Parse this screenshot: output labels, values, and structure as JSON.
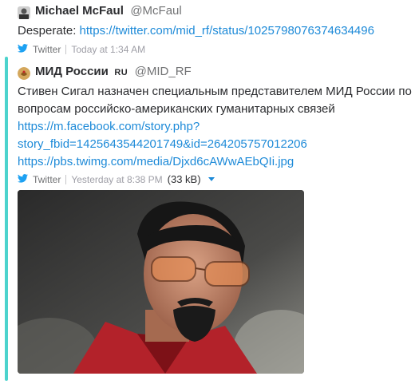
{
  "tweet1": {
    "author": "Michael McFaul",
    "handle": "@McFaul",
    "text_prefix": "Desperate: ",
    "link": "https://twitter.com/mid_rf/status/1025798076374634496",
    "source": "Twitter",
    "time": "Today at 1:34 AM"
  },
  "tweet2": {
    "author": "МИД России",
    "author_suffix": "RU",
    "handle": "@MID_RF",
    "text_line1": "Стивен Сигал назначен специальным представителем МИД России по",
    "text_line2": "вопросам российско-американских гуманитарных связей",
    "link1_line1": "https://m.facebook.com/story.php?",
    "link1_line2": "story_fbid=1425643544201749&id=264205757012206",
    "link2": "https://pbs.twimg.com/media/Djxd6cAWwAEbQIi.jpg",
    "source": "Twitter",
    "time": "Yesterday at 8:38 PM",
    "size": "(33 kB)"
  },
  "icons": {
    "twitter": "twitter-bird-icon",
    "caret": "caret-down-icon"
  },
  "colors": {
    "link": "#1d8ad8",
    "quote_bar": "#4cd3cd",
    "twitter_blue": "#1da1f2"
  }
}
